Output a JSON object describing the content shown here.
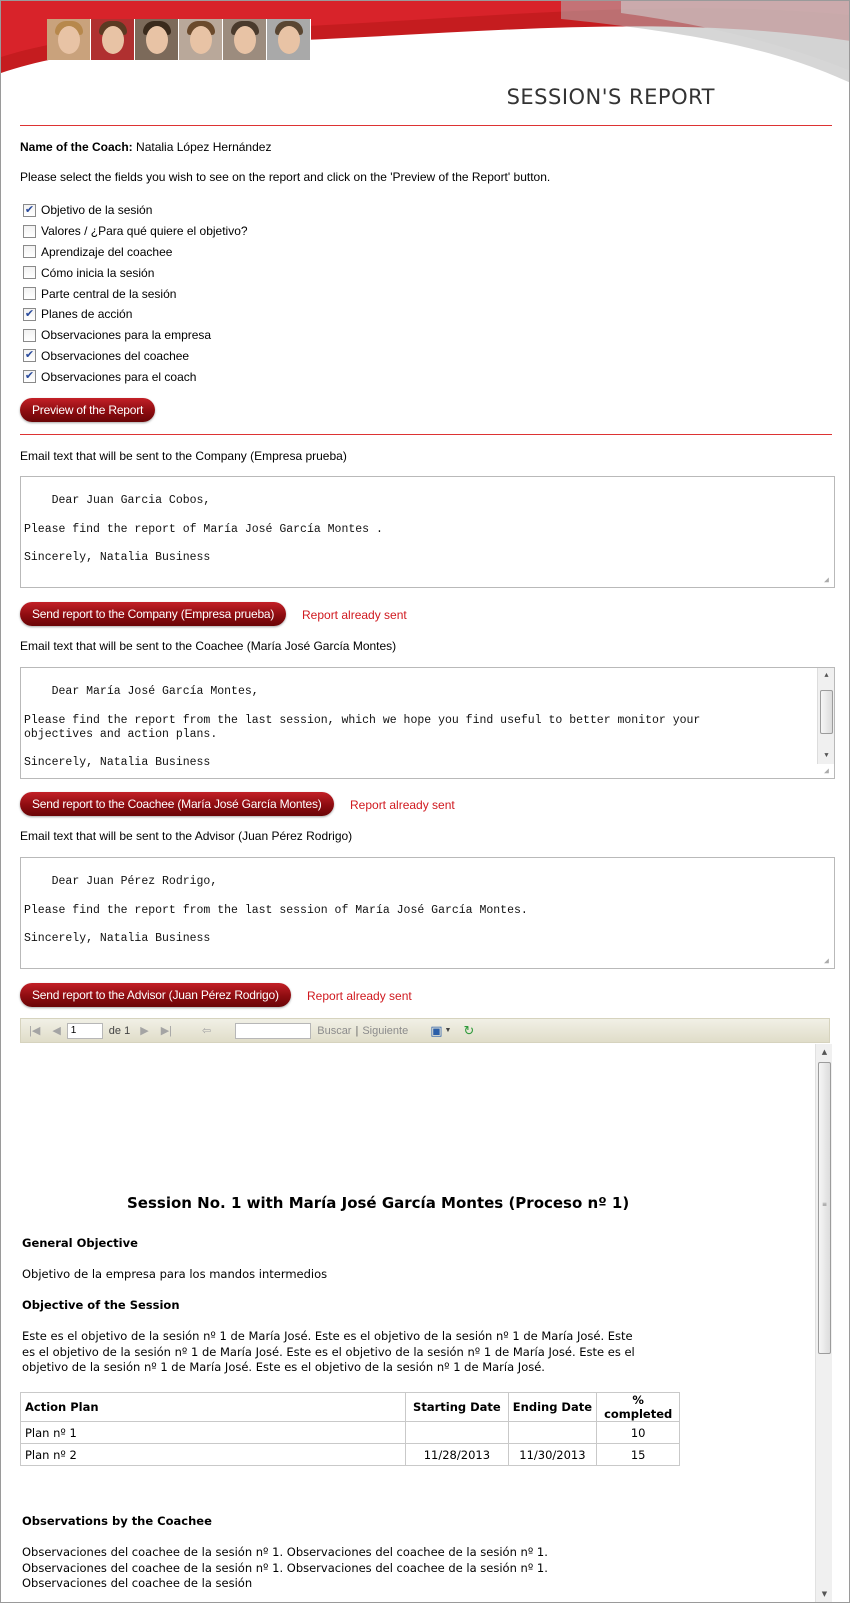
{
  "header": {
    "title": "SESSION'S REPORT",
    "brand_color": "#d0191f"
  },
  "coach": {
    "label": "Name of the Coach:",
    "name": "Natalia López Hernández"
  },
  "instruction": "Please select the fields you wish to see on the report and click on the 'Preview of the Report' button.",
  "fields": [
    {
      "label": "Objetivo de la sesión",
      "checked": true
    },
    {
      "label": "Valores / ¿Para qué quiere el objetivo?",
      "checked": false
    },
    {
      "label": "Aprendizaje del coachee",
      "checked": false
    },
    {
      "label": "Cómo inicia la sesión",
      "checked": false
    },
    {
      "label": "Parte central de la sesión",
      "checked": false
    },
    {
      "label": "Planes de acción",
      "checked": true
    },
    {
      "label": "Observaciones para la empresa",
      "checked": false
    },
    {
      "label": "Observaciones del coachee",
      "checked": true
    },
    {
      "label": "Observaciones para el coach",
      "checked": true
    }
  ],
  "preview_button": "Preview of the Report",
  "company": {
    "label": "Email text that will be sent to the Company (Empresa prueba)",
    "text": "Dear Juan Garcia Cobos,\n\nPlease find the report of María José García Montes .\n\nSincerely, Natalia Business",
    "button": "Send report to the Company (Empresa prueba)",
    "status": "Report already sent"
  },
  "coachee": {
    "label": "Email text that will be sent to the Coachee (María José García Montes)",
    "text": "Dear María José García Montes,\n\nPlease find the report from the last session, which we hope you find useful to better monitor your\nobjectives and action plans.\n\nSincerely, Natalia Business",
    "button": "Send report to the Coachee (María José García Montes)",
    "status": "Report already sent"
  },
  "advisor": {
    "label": "Email text that will be sent to the Advisor (Juan Pérez Rodrigo)",
    "text": "Dear Juan Pérez Rodrigo,\n\nPlease find the report from the last session of María José García Montes.\n\nSincerely, Natalia Business",
    "button": "Send report to the Advisor (Juan Pérez Rodrigo)",
    "status": "Report already sent"
  },
  "toolbar": {
    "page_value": "1",
    "page_of": "de 1",
    "find_placeholder": "",
    "find_label": "Buscar",
    "separator": "|",
    "next_label": "Siguiente"
  },
  "report": {
    "title": "Session No. 1 with María José García Montes (Proceso nº 1)",
    "general_objective_heading": "General Objective",
    "general_objective_text": "Objetivo de la empresa para los mandos intermedios",
    "session_objective_heading": "Objective of the Session",
    "session_objective_text": "Este es el objetivo de la sesión nº 1 de María José. Este es el objetivo de la sesión nº 1 de María José. Este es el objetivo de la sesión nº 1 de María José. Este es el objetivo de la sesión nº 1 de María José. Este es el objetivo de la sesión nº 1 de María José. Este es el objetivo de la sesión nº 1 de María José.",
    "plan_headers": [
      "Action Plan",
      "Starting Date",
      "Ending Date",
      "% completed"
    ],
    "plan_rows": [
      [
        "Plan nº 1",
        "",
        "",
        "10"
      ],
      [
        "Plan nº 2",
        "11/28/2013",
        "11/30/2013",
        "15"
      ]
    ],
    "coachee_obs_heading": "Observations by the Coachee",
    "coachee_obs_text": "Observaciones del coachee de la sesión nº 1. Observaciones del coachee de la sesión nº 1. Observaciones del coachee de la sesión nº 1. Observaciones del coachee de la sesión nº 1. Observaciones del coachee de la sesión"
  }
}
